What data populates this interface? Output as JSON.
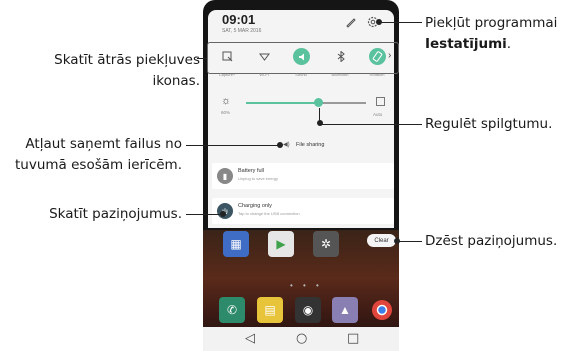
{
  "callouts": {
    "quick_access": [
      "Skatīt ātrās piekļuves",
      "ikonas."
    ],
    "settings_line1": "Piekļūt programmai",
    "settings_bold": "Iestatījumi",
    "settings_period": ".",
    "brightness": "Regulēt spilgtumu.",
    "file_sharing": [
      "Atļaut saņemt failus no",
      "tuvumā esošām ierīcēm."
    ],
    "notifications": "Skatīt paziņojumus.",
    "clear": "Dzēst paziņojumus."
  },
  "phone": {
    "time": "09:01",
    "date": "SAT, 5 MAR 2016",
    "quick_settings": [
      {
        "label": "Capture+",
        "icon": "capture-icon",
        "active": false
      },
      {
        "label": "Wi-Fi",
        "icon": "wifi-icon",
        "active": false
      },
      {
        "label": "Sound",
        "icon": "sound-icon",
        "active": true
      },
      {
        "label": "Bluetooth",
        "icon": "bluetooth-icon",
        "active": false
      },
      {
        "label": "Rotation",
        "icon": "rotation-icon",
        "active": true
      }
    ],
    "brightness_percent": "60%",
    "brightness_level": 0.6,
    "auto_label": "Auto",
    "file_sharing_label": "File sharing",
    "notifications": [
      {
        "title": "Battery full",
        "subtitle": "Unplug to save energy"
      },
      {
        "title": "Charging only",
        "subtitle": "Tap to change the USB connection"
      }
    ],
    "clear_label": "Clear",
    "accent_color": "#5bc29e"
  }
}
